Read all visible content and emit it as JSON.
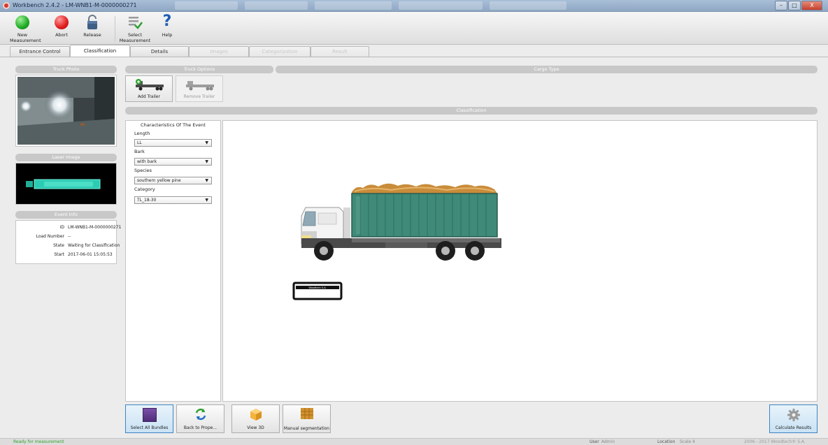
{
  "window": {
    "title": "Workbench 2.4.2 - LM-WNB1-M-0000000271",
    "controls": {
      "minimize": "–",
      "maximize": "□",
      "close": "X"
    }
  },
  "toolbar": {
    "new_measurement": "New Measurement",
    "abort": "Abort",
    "release": "Release",
    "select_measurement": "Select Measurement",
    "help": "Help"
  },
  "tabs": [
    {
      "label": "Entrance Control",
      "state": "normal"
    },
    {
      "label": "Classification",
      "state": "active"
    },
    {
      "label": "Details",
      "state": "normal"
    },
    {
      "label": "Images",
      "state": "disabled"
    },
    {
      "label": "Categorization",
      "state": "disabled"
    },
    {
      "label": "Result",
      "state": "disabled"
    }
  ],
  "left": {
    "truck_photo_title": "Truck Photo",
    "laser_image_title": "Laser Image",
    "event_info_title": "Event Info",
    "event_info": [
      {
        "key": "ID",
        "value": "LM-WNB1-M-0000000271"
      },
      {
        "key": "Load Number",
        "value": "--"
      },
      {
        "key": "State",
        "value": "Waiting for Classification"
      },
      {
        "key": "Start",
        "value": "2017-06-01 15:05:53"
      }
    ]
  },
  "truck_options": {
    "title": "Truck Options",
    "add_trailer": "Add Trailer",
    "remove_trailer": "Remove Trailer"
  },
  "cargo_type": {
    "title": "Cargo Type"
  },
  "classification": {
    "title": "Classification"
  },
  "characteristics": {
    "title": "Characteristics Of The Event",
    "fields": [
      {
        "label": "Length",
        "value": "LL"
      },
      {
        "label": "Bark",
        "value": "with bark"
      },
      {
        "label": "Species",
        "value": "southern yellow pine"
      },
      {
        "label": "Category",
        "value": "TL_18-30"
      }
    ]
  },
  "canvas": {
    "plate_text": "Woodtech S.A."
  },
  "bottom": {
    "select_all_bundles": "Select All Bundles",
    "back_to_prope": "Back to Prope...",
    "view_3d": "View 3D",
    "manual_segmentation": "Manual segmentation",
    "calculate_results": "Calculate Results"
  },
  "status": {
    "left": "Ready for measurement",
    "user_label": "User",
    "user_value": "Admin",
    "location_label": "Location",
    "location_value": "Scale 4",
    "copyright": "2006 - 2017 Woodtech® S.A."
  },
  "colors": {
    "status_ok": "#2fa22f",
    "accent_blue": "#3b84c4",
    "section_bar": "#c8c8c8",
    "container": "#3f8a78"
  }
}
